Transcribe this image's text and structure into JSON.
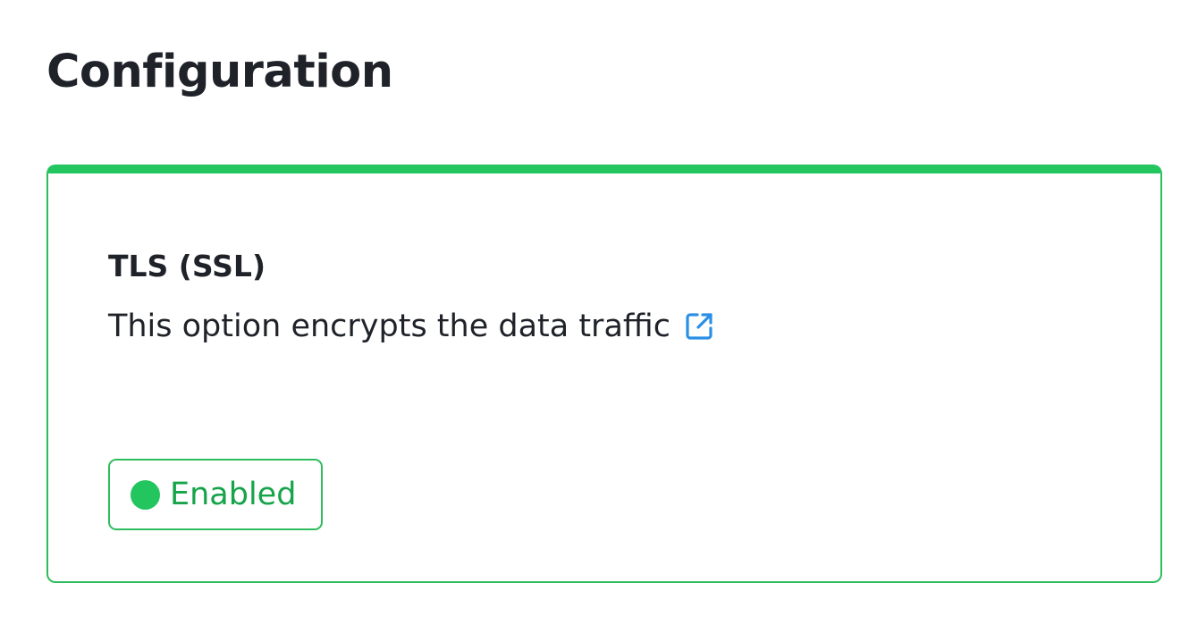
{
  "page": {
    "title": "Configuration"
  },
  "tls_card": {
    "title": "TLS (SSL)",
    "description": "This option encrypts the data traffic",
    "link_icon": "external-link-icon",
    "status": {
      "label": "Enabled",
      "indicator": "status-dot-icon"
    }
  },
  "colors": {
    "accent": "#22c55e",
    "border": "#2ebd5c",
    "status_text": "#16a34a",
    "link": "#2b8fe6",
    "text": "#1f2329"
  }
}
